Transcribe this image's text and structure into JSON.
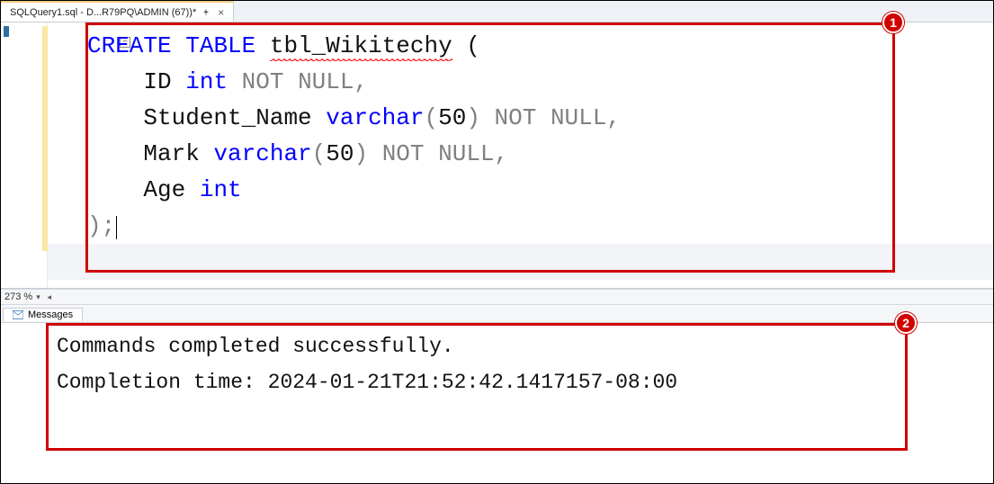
{
  "tab": {
    "title": "SQLQuery1.sql - D...R79PQ\\ADMIN (67))*"
  },
  "editor": {
    "fold_glyph": "−",
    "zoom": "273 %",
    "code": {
      "line1": {
        "kw1": "CREATE",
        "kw2": "TABLE",
        "sp": " ",
        "name": "tbl_Wikitechy",
        "tail": " ("
      },
      "line2": {
        "indent": "    ",
        "col": "ID ",
        "typ": "int",
        "sp": " ",
        "null": "NOT NULL",
        "comma": ","
      },
      "line3": {
        "indent": "    ",
        "col": "Student_Name ",
        "typ": "varchar",
        "p1": "(",
        "size": "50",
        "p2": ") ",
        "null": "NOT NULL",
        "comma": ","
      },
      "line4": {
        "indent": "    ",
        "col": "Mark ",
        "typ": "varchar",
        "p1": "(",
        "size": "50",
        "p2": ") ",
        "null": "NOT NULL",
        "comma": ","
      },
      "line5": {
        "indent": "    ",
        "col": "Age ",
        "typ": "int"
      },
      "line6": {
        "close": ");"
      }
    }
  },
  "messages": {
    "tab_label": "Messages",
    "line1": "Commands completed successfully.",
    "line2": "",
    "line3": "Completion time: 2024-01-21T21:52:42.1417157-08:00"
  },
  "annotations": {
    "badge1": "1",
    "badge2": "2"
  }
}
